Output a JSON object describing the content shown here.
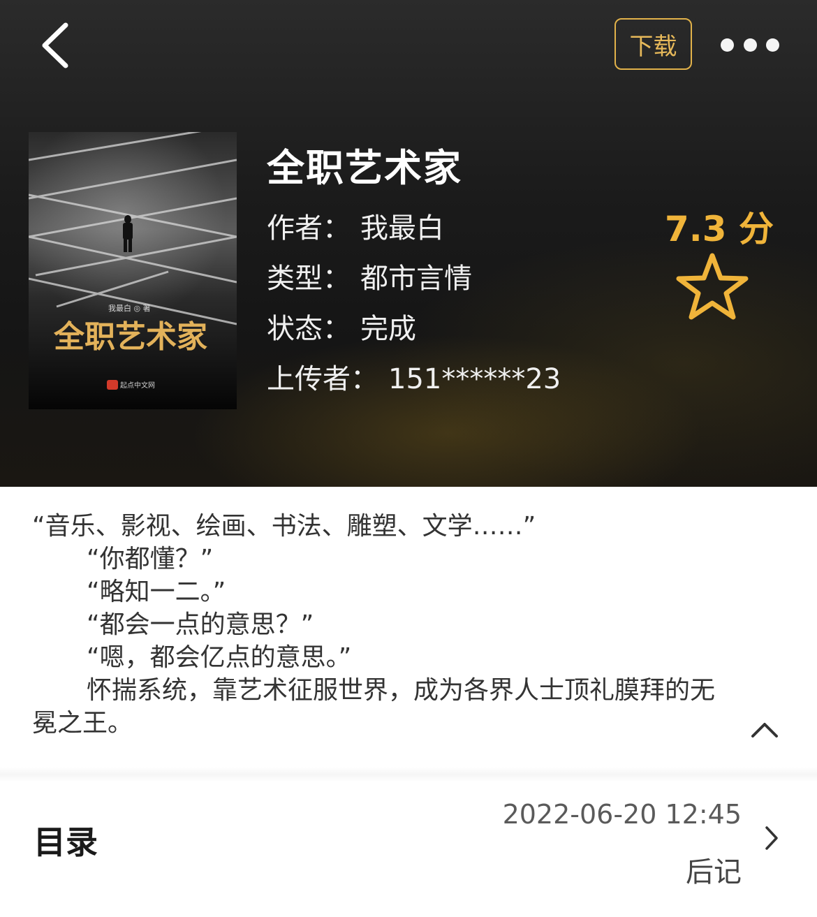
{
  "header": {
    "download_label": "下载"
  },
  "book": {
    "title": "全职艺术家",
    "cover": {
      "author_text": "我最白 ◎ 著",
      "title_text": "全职艺术家",
      "publisher_text": "起点中文网"
    },
    "author_label": "作者：",
    "author": "我最白",
    "genre_label": "类型：",
    "genre": "都市言情",
    "status_label": "状态：",
    "status": "完成",
    "uploader_label": "上传者：",
    "uploader": "151******23",
    "rating": "7.3 分"
  },
  "synopsis": {
    "lines": [
      "“音乐、影视、绘画、书法、雕塑、文学……”",
      "“你都懂？”",
      "“略知一二。”",
      "“都会一点的意思？”",
      "“嗯，都会亿点的意思。”",
      "怀揣系统，靠艺术征服世界，成为各界人士顶礼膜拜的无冕之王。"
    ]
  },
  "toc": {
    "title": "目录",
    "updated": "2022-06-20 12:45",
    "latest_chapter": "后记"
  },
  "colors": {
    "accent_gold": "#e7b95a",
    "rating_gold": "#f0b43a"
  },
  "icons": [
    "chevron-left-icon",
    "more-icon",
    "star-icon",
    "chevron-up-icon",
    "chevron-right-icon"
  ]
}
